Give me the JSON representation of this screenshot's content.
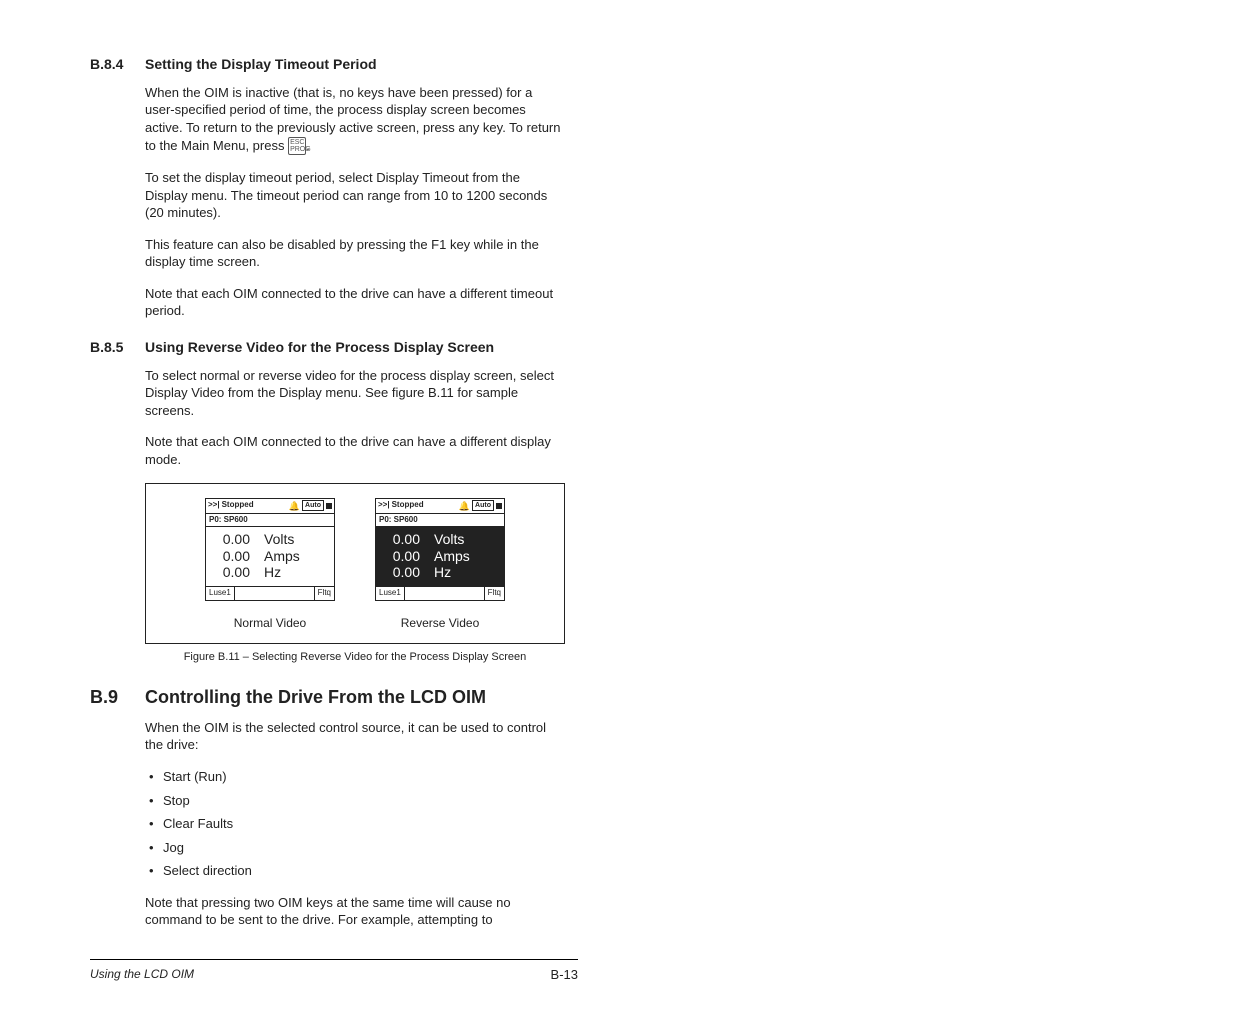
{
  "s1": {
    "num": "B.8.4",
    "title": "Setting the Display Timeout Period",
    "p1a": "When the OIM is inactive (that is, no keys have been pressed) for a user-specified period of time, the process display screen becomes active. To return to the previously active screen, press any key. To return to the Main Menu, press ",
    "key": "ESC PROG",
    "p1b": ".",
    "p2": "To set the display timeout period, select Display Timeout from the Display menu. The timeout period can range from 10 to 1200 seconds (20 minutes).",
    "p3": "This feature can also be disabled by pressing the F1 key while in the display time screen.",
    "p4": "Note that each OIM connected to the drive can have a different timeout period."
  },
  "s2": {
    "num": "B.8.5",
    "title": "Using Reverse Video for the Process Display Screen",
    "p1": "To select normal or reverse video for the process display screen, select Display Video from the Display menu. See figure B.11 for sample screens.",
    "p2": "Note that each OIM connected to the drive can have a different display mode."
  },
  "fig": {
    "top_status": "Stopped",
    "top_auto": "Auto",
    "p0": "P0: SP600",
    "rows": [
      {
        "val": "0.00",
        "unit": "Volts"
      },
      {
        "val": "0.00",
        "unit": "Amps"
      },
      {
        "val": "0.00",
        "unit": "Hz"
      }
    ],
    "bot_left": "Luse1",
    "bot_right": "Fltq",
    "label_normal": "Normal Video",
    "label_reverse": "Reverse Video",
    "caption": "Figure B.11 – Selecting Reverse Video for the Process Display Screen"
  },
  "s3": {
    "num": "B.9",
    "title": "Controlling the Drive From the LCD OIM",
    "p1": "When the OIM is the selected control source, it can be used to control the drive:",
    "bullets": [
      "Start (Run)",
      "Stop",
      "Clear Faults",
      "Jog",
      "Select direction"
    ],
    "p2": "Note that pressing two OIM keys at the same time will cause no command to be sent to the drive. For example, attempting to"
  },
  "footer": {
    "left": "Using the LCD OIM",
    "right": "B-13"
  }
}
